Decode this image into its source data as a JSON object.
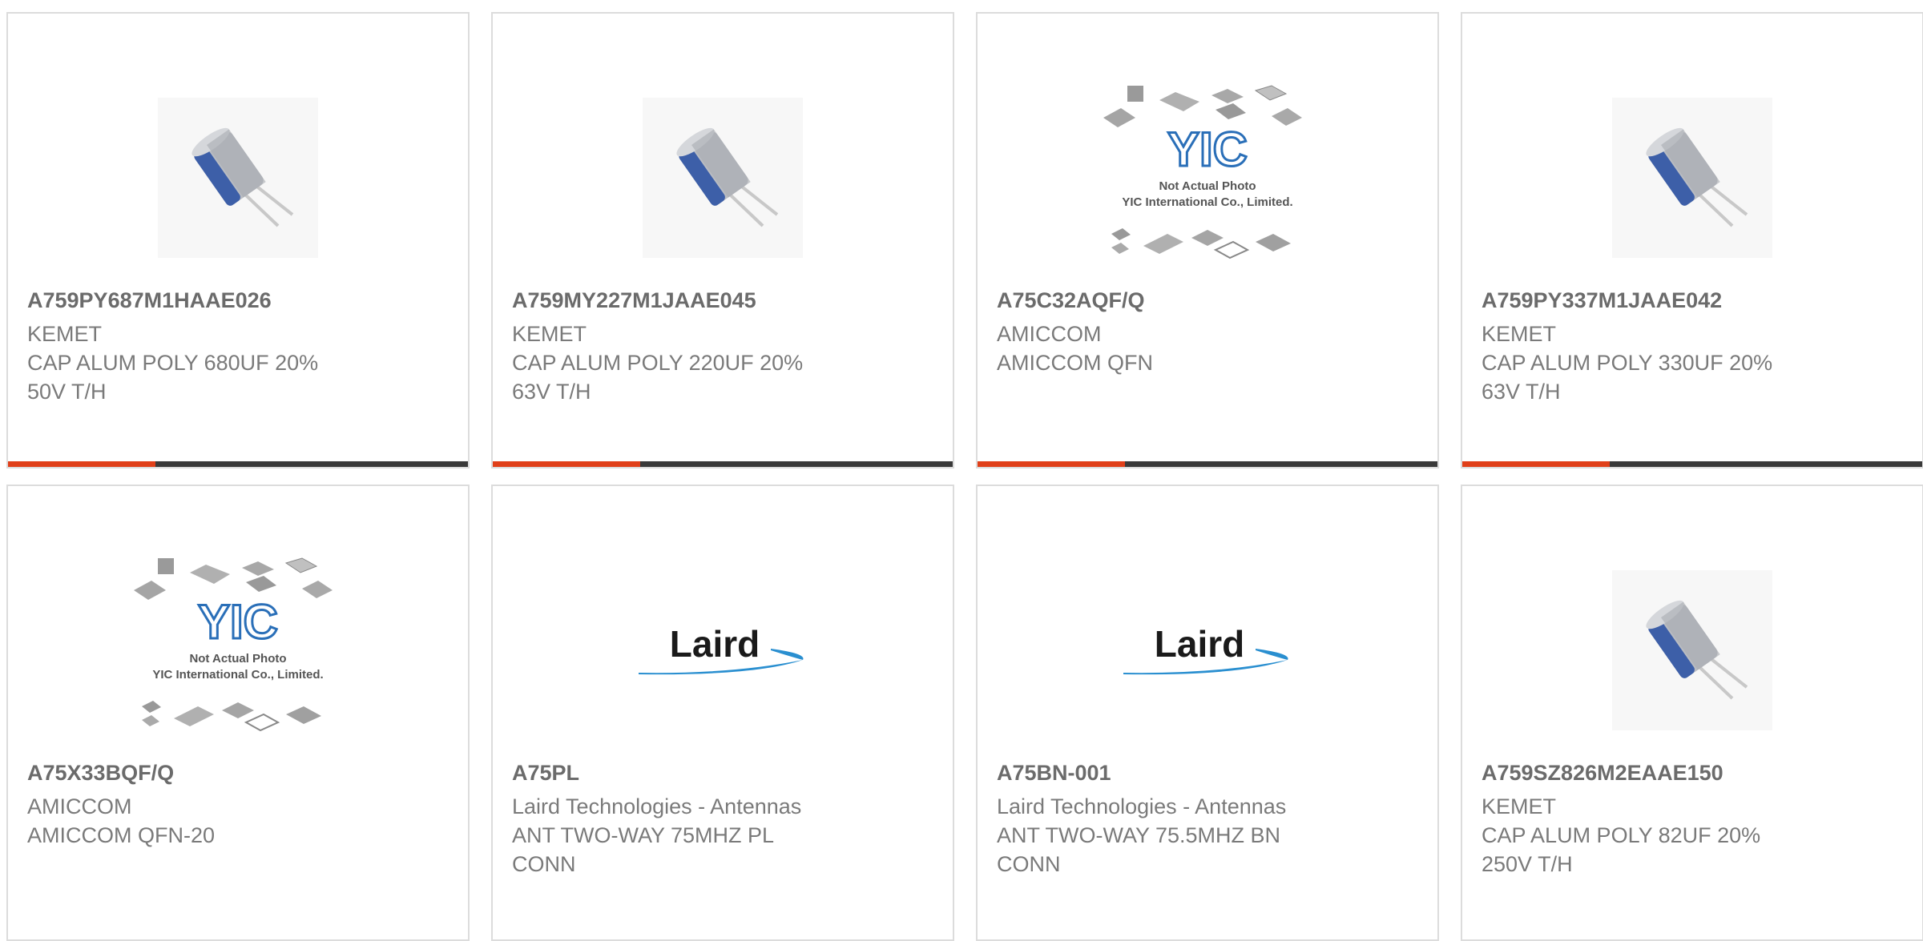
{
  "colors": {
    "card_border": "#dcdcdc",
    "accent_bar": "#e0401a",
    "dark_bar": "#3a3a3a",
    "text": "#7a7a7a",
    "part_number": "#6b6b6b"
  },
  "products": [
    {
      "part_number": "A759PY687M1HAAE026",
      "manufacturer": "KEMET",
      "description_line1": "CAP ALUM POLY 680UF 20%",
      "description_line2": "50V T/H",
      "image": "capacitor-icon"
    },
    {
      "part_number": "A759MY227M1JAAE045",
      "manufacturer": "KEMET",
      "description_line1": "CAP ALUM POLY 220UF 20%",
      "description_line2": "63V T/H",
      "image": "capacitor-icon"
    },
    {
      "part_number": "A75C32AQF/Q",
      "manufacturer": "AMICCOM",
      "description_line1": "AMICCOM QFN",
      "description_line2": "",
      "image": "yic-placeholder-icon",
      "image_text1": "Not Actual Photo",
      "image_text2": "YIC International Co., Limited.",
      "image_logo": "YIC"
    },
    {
      "part_number": "A759PY337M1JAAE042",
      "manufacturer": "KEMET",
      "description_line1": "CAP ALUM POLY 330UF 20%",
      "description_line2": "63V T/H",
      "image": "capacitor-icon"
    },
    {
      "part_number": "A75X33BQF/Q",
      "manufacturer": "AMICCOM",
      "description_line1": "AMICCOM QFN-20",
      "description_line2": "",
      "image": "yic-placeholder-icon",
      "image_text1": "Not Actual Photo",
      "image_text2": "YIC International Co., Limited.",
      "image_logo": "YIC"
    },
    {
      "part_number": "A75PL",
      "manufacturer": "Laird Technologies - Antennas",
      "description_line1": "ANT TWO-WAY 75MHZ PL",
      "description_line2": "CONN",
      "image": "laird-logo",
      "image_logo": "Laird"
    },
    {
      "part_number": "A75BN-001",
      "manufacturer": "Laird Technologies - Antennas",
      "description_line1": "ANT TWO-WAY 75.5MHZ BN",
      "description_line2": "CONN",
      "image": "laird-logo",
      "image_logo": "Laird"
    },
    {
      "part_number": "A759SZ826M2EAAE150",
      "manufacturer": "KEMET",
      "description_line1": "CAP ALUM POLY 82UF 20%",
      "description_line2": "250V T/H",
      "image": "capacitor-icon"
    }
  ]
}
